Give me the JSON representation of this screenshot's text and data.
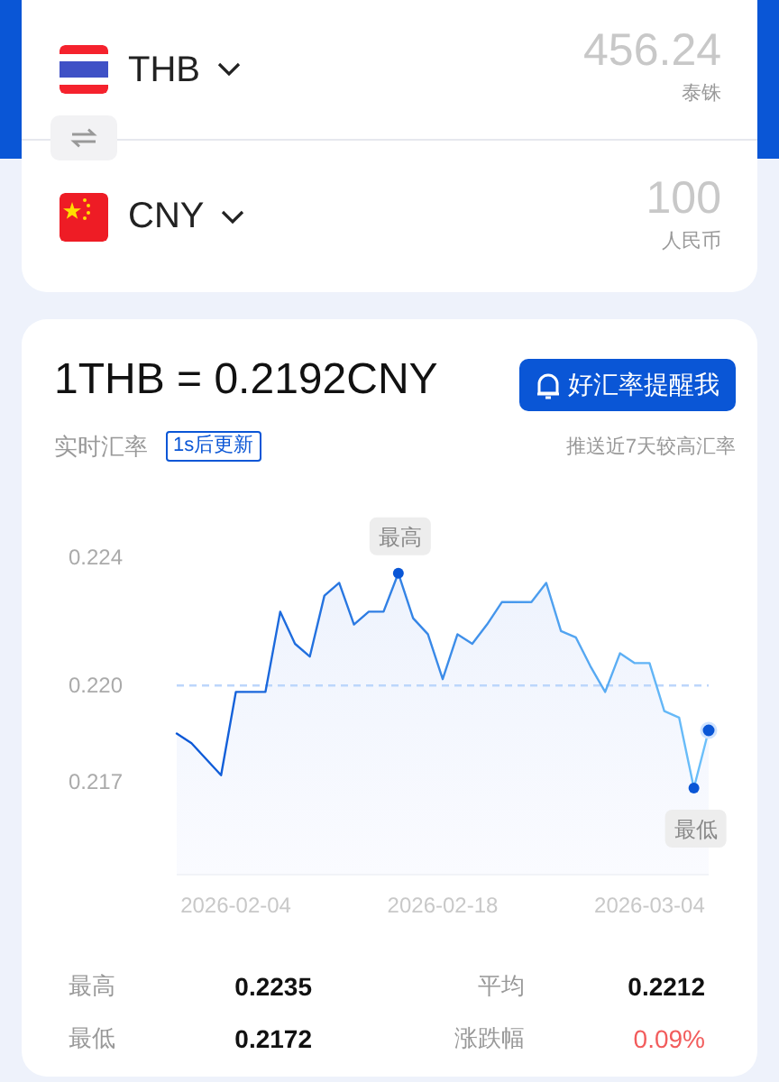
{
  "converter": {
    "rows": [
      {
        "code": "THB",
        "kind": "thailand",
        "amount": "456.24",
        "currency_name": "泰铢"
      },
      {
        "code": "CNY",
        "kind": "china",
        "amount": "100",
        "currency_name": "人民币"
      }
    ]
  },
  "rate": {
    "title": "1THB = 0.2192CNY",
    "label": "实时汇率",
    "update_badge": "1s后更新",
    "alert_button": "好汇率提醒我",
    "alert_note": "推送近7天较高汇率",
    "chart_data": {
      "type": "area",
      "ylim": [
        0.2141,
        0.224
      ],
      "categories": [
        null,
        null,
        null,
        null,
        "2026-02-04",
        null,
        null,
        null,
        null,
        null,
        null,
        null,
        null,
        null,
        null,
        null,
        null,
        null,
        "2026-02-18",
        null,
        null,
        null,
        null,
        null,
        null,
        null,
        null,
        null,
        null,
        null,
        null,
        null,
        "2026-03-04",
        null,
        null,
        null,
        null
      ],
      "yticks": [
        {
          "value": 0.224,
          "label": "0.224"
        },
        {
          "value": 0.22,
          "label": "0.220"
        },
        {
          "value": 0.217,
          "label": "0.217"
        }
      ],
      "series": [
        {
          "color": "#0a56d6",
          "values": [
            0.2185,
            0.2182,
            0.2177,
            0.2172,
            0.2198,
            0.2198,
            0.2198,
            0.2223,
            0.2213,
            0.2209,
            0.2228,
            0.2232,
            0.2219,
            0.2223,
            0.2223,
            0.2235,
            0.2221,
            0.2216,
            0.2202,
            0.2216,
            0.2213,
            0.2219,
            0.2226,
            0.2226,
            0.2226,
            0.2232,
            0.2217,
            0.2215,
            0.2206,
            0.2198,
            0.221,
            0.2207,
            0.2207,
            0.2192,
            0.219,
            0.2168,
            0.2186
          ]
        }
      ],
      "ref_lines": [
        {
          "axis": "y",
          "value": 0.22
        }
      ],
      "annotations": [
        {
          "text": "最高",
          "y": 0.2235
        },
        {
          "text": "最低",
          "y": 0.2168
        }
      ]
    }
  },
  "stats": [
    {
      "label": "最高",
      "value": "0.2235"
    },
    {
      "label": "平均",
      "value": "0.2212"
    },
    {
      "label": "最低",
      "value": "0.2172"
    },
    {
      "label": "涨跌幅",
      "value": "0.09%",
      "color": "#f25c5c"
    }
  ]
}
